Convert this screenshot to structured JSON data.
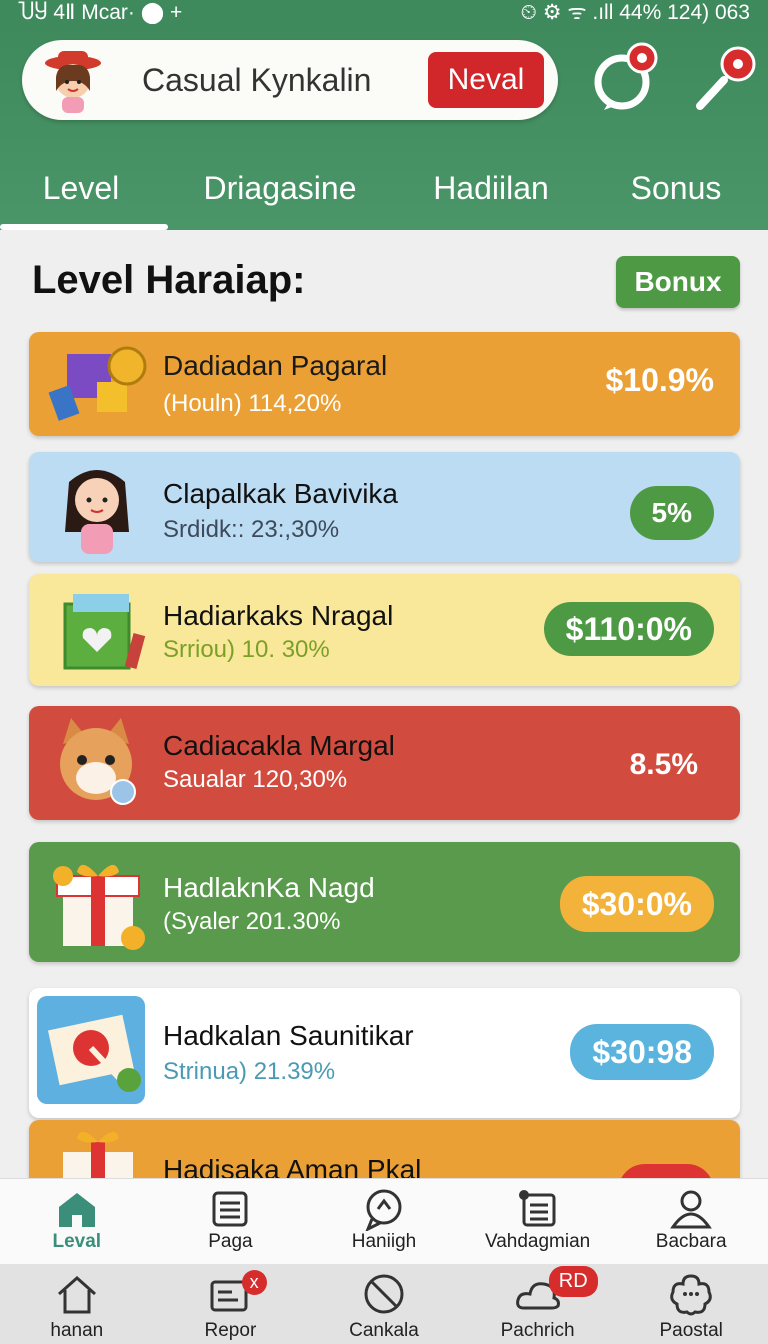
{
  "status_bar": {
    "left": "ႮႸ 4Ⅱ Mcar· ⬤ +",
    "right": "⏲ ⚙ ᯤ .ıll 44% 124) 063"
  },
  "header": {
    "app_title": "Casual Kynkalin",
    "action_label": "Neval",
    "tabs": [
      {
        "label": "Level",
        "active": true
      },
      {
        "label": "Driagasine"
      },
      {
        "label": "Hadiilan"
      },
      {
        "label": "Sonus"
      }
    ]
  },
  "section": {
    "title": "Level Haraiap:",
    "bonus_label": "Bonux"
  },
  "cards": [
    {
      "name": "Dadiadan Pagaral",
      "sub": "(Houln) 114,20%",
      "value": "$10.9%",
      "bg": "#eaa035",
      "name_color": "#1a1a1a",
      "sub_color": "#fff",
      "badge_style": "plain"
    },
    {
      "name": "Clapalkak Bavivika",
      "sub": "Srdidk:: 23:,30%",
      "value": "5%",
      "bg": "#bcdcf4",
      "name_color": "#111",
      "sub_color": "#3d4a5a",
      "badge_style": "green"
    },
    {
      "name": "Hadiarkaks Nragal",
      "sub": "Srriou) 10. 30%",
      "value": "$110:0%",
      "bg": "#f9e79a",
      "name_color": "#111",
      "sub_color": "#7aa02a",
      "badge_style": "green"
    },
    {
      "name": "Cadiacakla Margal",
      "sub": "Saualar 120,30%",
      "value": "8.5%",
      "bg": "#d14c3e",
      "name_color": "#111",
      "sub_color": "#fff",
      "badge_style": "plain"
    },
    {
      "name": "HadlaknKa Nagd",
      "sub": "(Syaler 201.30%",
      "value": "$30:0%",
      "bg": "#5a9a4c",
      "name_color": "#fff",
      "sub_color": "#fff",
      "badge_style": "orange"
    },
    {
      "name": "Hadkalan Saunitikar",
      "sub": "Strinua) 21.39%",
      "value": "$30:98",
      "bg": "#ffffff",
      "name_color": "#111",
      "sub_color": "#4a9ab3",
      "badge_style": "blue"
    },
    {
      "name": "Hadisaka Aman Pkal",
      "sub": "",
      "value": "",
      "bg": "#eaa035",
      "name_color": "#111",
      "sub_color": "#fff",
      "badge_style": "red"
    }
  ],
  "nav_primary": [
    {
      "label": "Leval",
      "icon": "home-icon",
      "active": true
    },
    {
      "label": "Paga",
      "icon": "document-icon"
    },
    {
      "label": "Haniigh",
      "icon": "chat-icon"
    },
    {
      "label": "Vahdagmian",
      "icon": "list-icon"
    },
    {
      "label": "Bacbara",
      "icon": "user-icon"
    }
  ],
  "nav_secondary": [
    {
      "label": "hanan",
      "icon": "house-outline-icon"
    },
    {
      "label": "Repor",
      "icon": "report-icon",
      "badge": "x"
    },
    {
      "label": "Cankala",
      "icon": "cancel-icon"
    },
    {
      "label": "Pachrich",
      "icon": "cloud-icon",
      "badge": "RD"
    },
    {
      "label": "Paostal",
      "icon": "flower-icon"
    }
  ],
  "colors": {
    "header_green": "#3f8a5c",
    "danger_red": "#d1272b",
    "bonus_green": "#4e9a44",
    "nav_active": "#3b8f7a"
  }
}
